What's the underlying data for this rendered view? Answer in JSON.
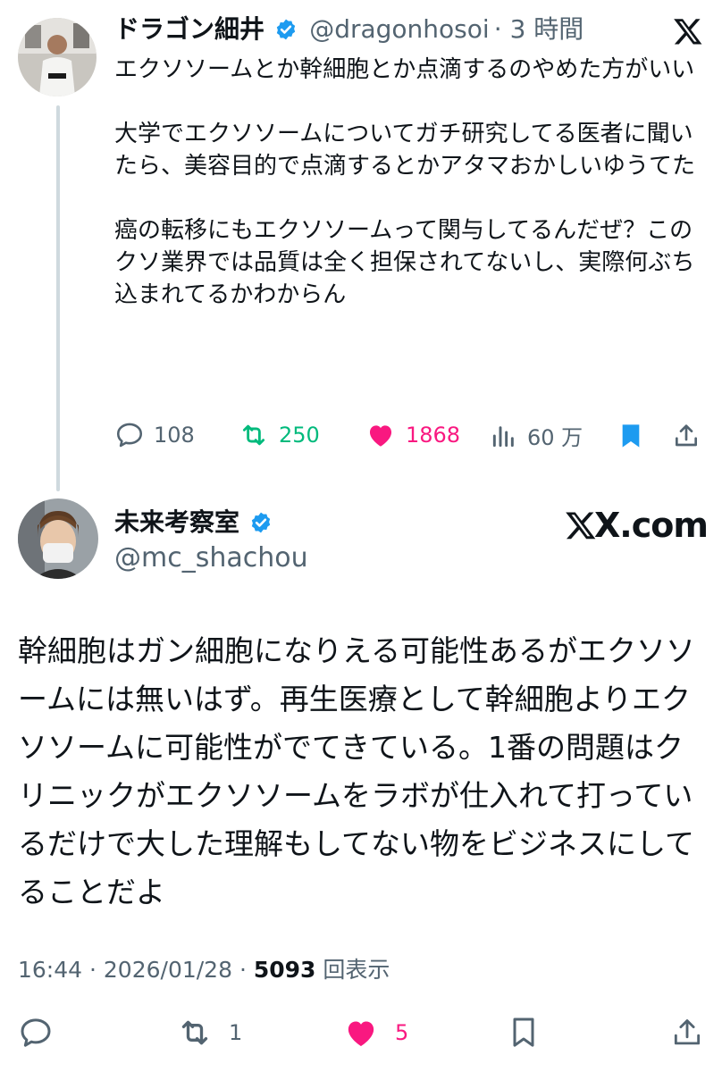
{
  "colors": {
    "verified": "#1d9bf0",
    "retweet": "#00ba7c",
    "like": "#f91880",
    "bookmark": "#1d9bf0",
    "muted": "#536471"
  },
  "post1": {
    "name": "ドラゴン細井",
    "handle": "@dragonhosoi",
    "time": "· 3 時間",
    "text": "エクソソームとか幹細胞とか点滴するのやめた方がいい\n\n大学でエクソソームについてガチ研究してる医者に聞いたら、美容目的で点滴するとかアタマおかしいゆうてた\n\n癌の転移にもエクソソームって関与してるんだぜ？このクソ業界では品質は全く担保されてないし、実際何ぶち込まれてるかわからん",
    "reply_count": "108",
    "retweet_count": "250",
    "like_count": "1868",
    "views": "60 万"
  },
  "post2": {
    "name": "未来考察室",
    "handle": "@mc_shachou",
    "brand": "X.com",
    "text": "幹細胞はガン細胞になりえる可能性あるがエクソソームには無いはず。再生医療として幹細胞よりエクソソームに可能性がでてきている。1番の問題はクリニックがエクソソームをラボが仕入れて打っているだけで大した理解もしてない物をビジネスにしてることだよ",
    "time": "16:44",
    "date": "2026/01/28",
    "views_count": "5093",
    "views_label": "回表示",
    "retweet_count": "1",
    "like_count": "5"
  },
  "icons": [
    "reply-icon",
    "retweet-icon",
    "like-icon",
    "views-icon",
    "bookmark-icon",
    "share-icon",
    "x-logo-icon",
    "verified-icon"
  ]
}
